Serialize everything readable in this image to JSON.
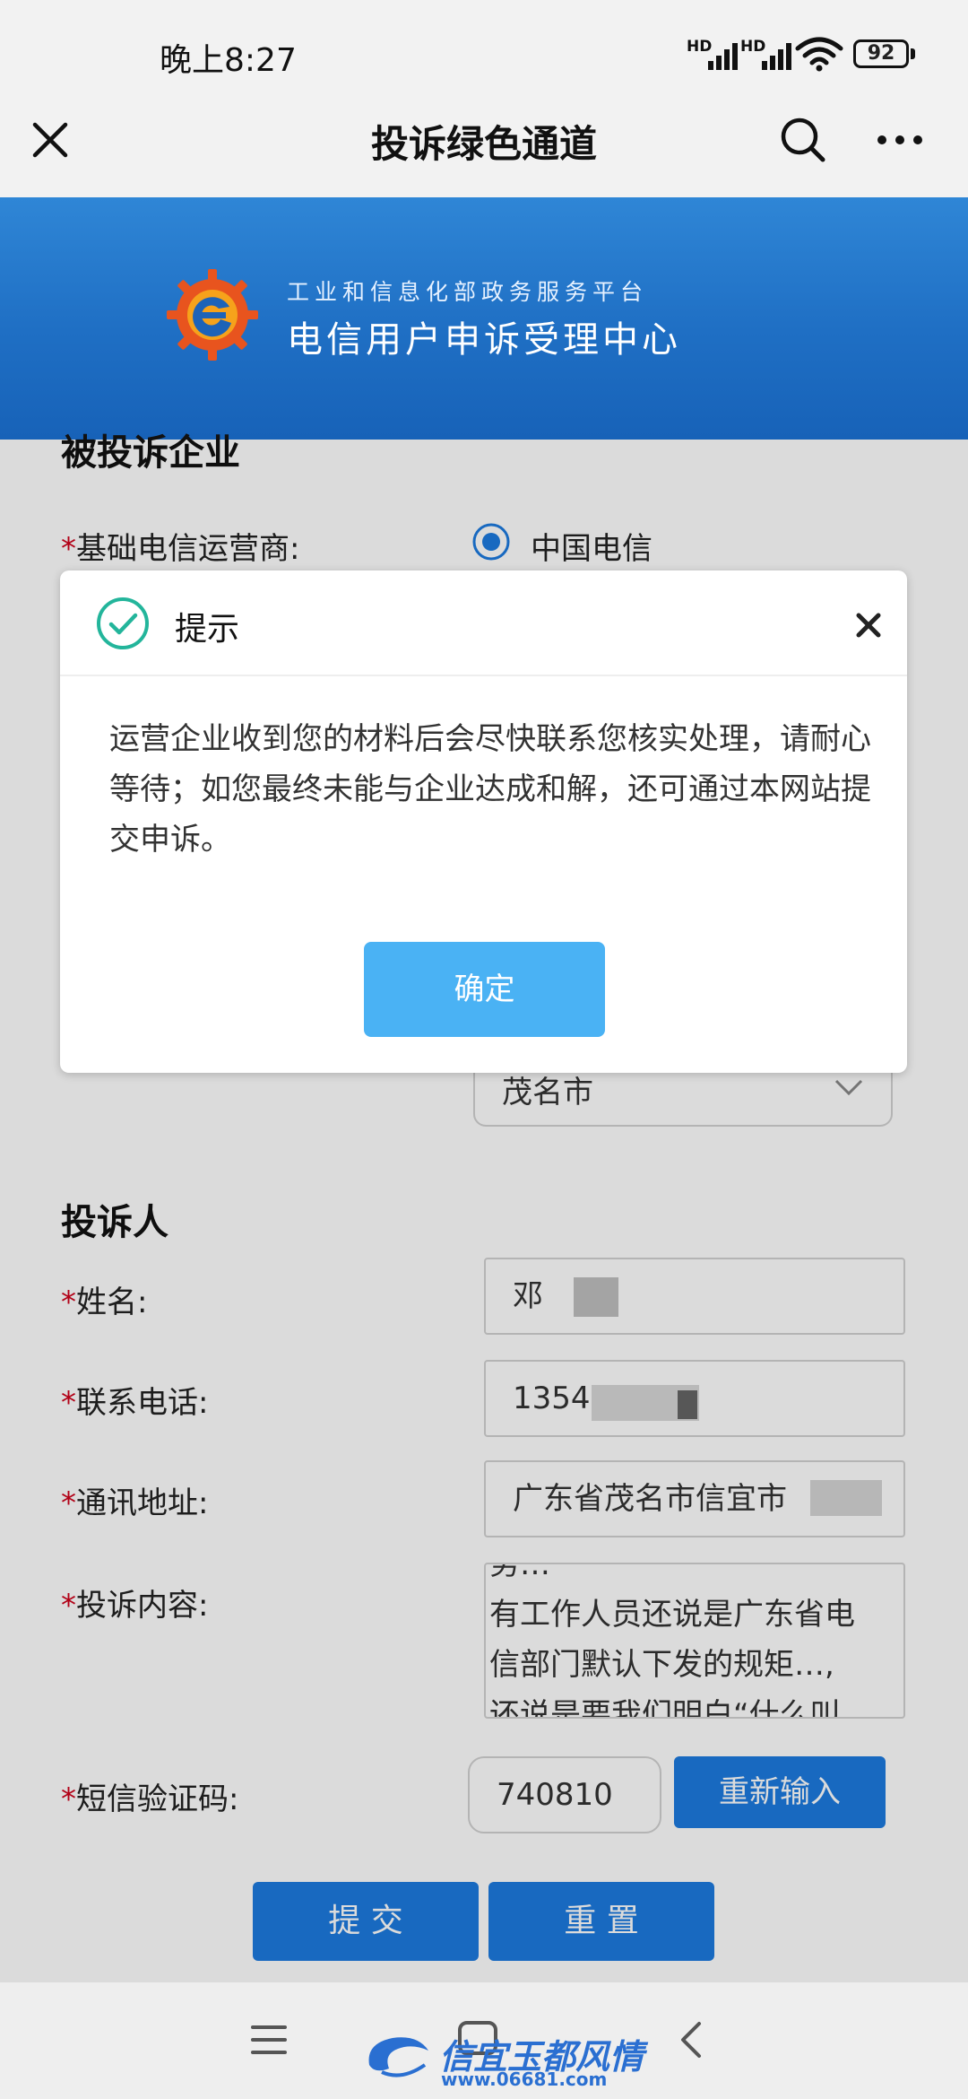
{
  "status_bar": {
    "time": "晚上8:27",
    "signal_1": "HD",
    "signal_2": "HD",
    "battery": "92"
  },
  "nav": {
    "title": "投诉绿色通道",
    "close_icon": "close-icon",
    "search_icon": "search-icon",
    "more_icon": "more-icon"
  },
  "banner": {
    "subtitle": "工业和信息化部政务服务平台",
    "title": "电信用户申诉受理中心"
  },
  "complained_company": {
    "section_title": "被投诉企业",
    "operator_label": "基础电信运营商:",
    "operator_value": "中国电信",
    "city_value": "茂名市"
  },
  "complainant": {
    "section_title": "投诉人",
    "name_label": "姓名:",
    "name_value": "邓",
    "phone_label": "联系电话:",
    "phone_value": "1354",
    "address_label": "通讯地址:",
    "address_value": "广东省茂名市信宜市",
    "content_label": "投诉内容:",
    "content_lines": [
      "务…",
      "有工作人员还说是广东省电",
      "信部门默认下发的规矩…,",
      "还说是要我们明白“什么叫"
    ],
    "sms_label": "短信验证码:",
    "sms_value": "740810",
    "reenter_button": "重新输入"
  },
  "actions": {
    "submit": "提 交",
    "reset": "重 置"
  },
  "dialog": {
    "title": "提示",
    "body": "运营企业收到您的材料后会尽快联系您核实处理，请耐心等待；如您最终未能与企业达成和解，还可通过本网站提交申诉。",
    "ok_button": "确定",
    "close_icon": "close-icon"
  },
  "watermark": {
    "text": "信宜玉都风情",
    "url": "www.06681.com"
  },
  "colors": {
    "banner_blue": "#1f6fc4",
    "button_blue": "#1c7be0",
    "ok_blue": "#4ab2f4",
    "required_red": "#d0021b",
    "check_green": "#23b59b"
  }
}
